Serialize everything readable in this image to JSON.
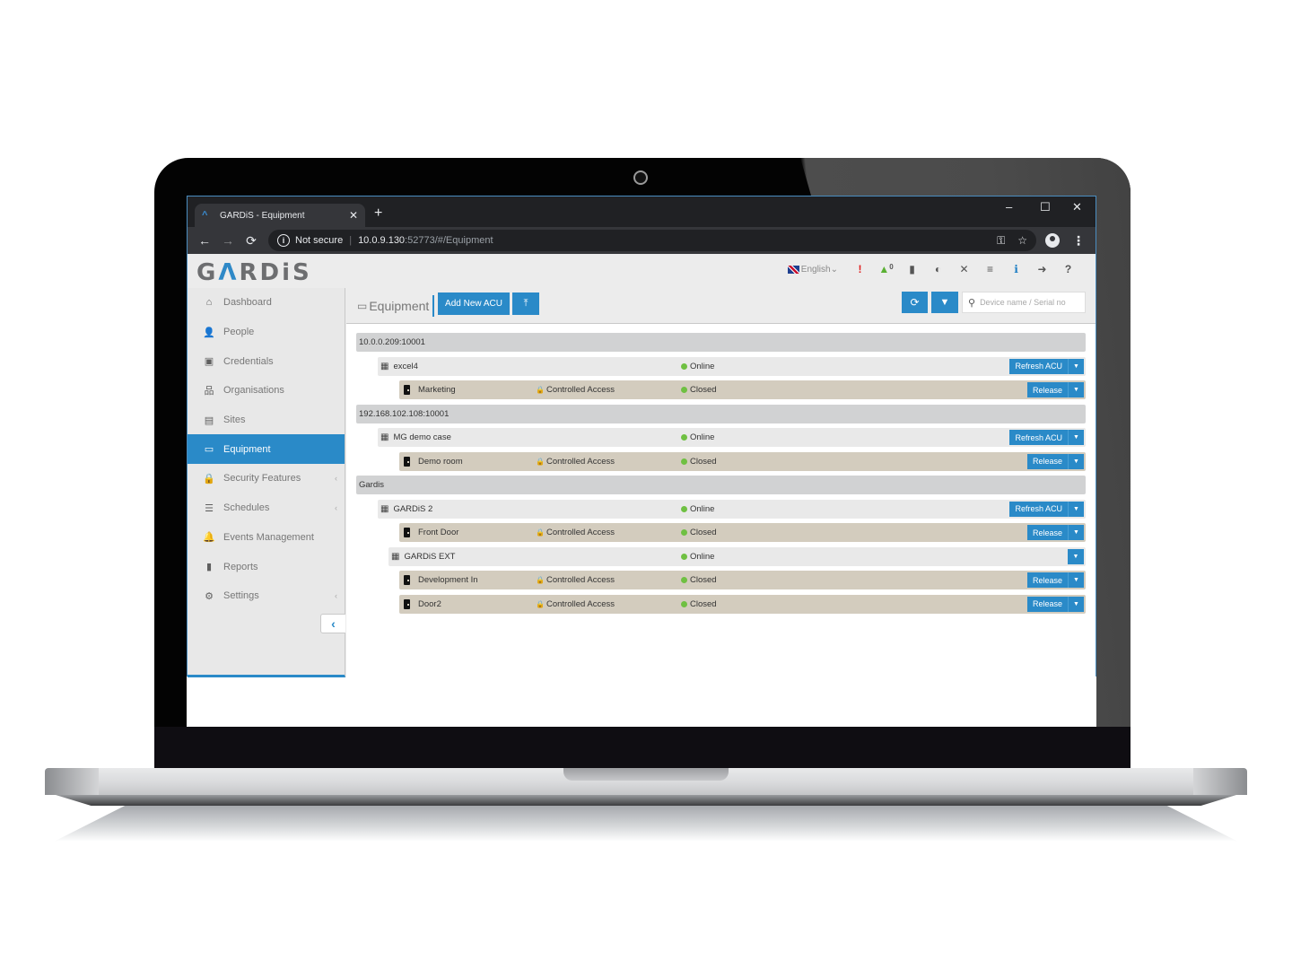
{
  "browser": {
    "tab_title": "GARDiS - Equipment",
    "tab_favicon": "gardis-chevron-icon",
    "new_tab": "+",
    "tab_close": "✕",
    "window_controls": {
      "minimize": "–",
      "maximize": "☐",
      "close": "✕"
    },
    "nav": {
      "back": "←",
      "forward": "→",
      "reload": "⟳"
    },
    "security_label": "Not secure",
    "url_host": "10.0.9.130",
    "url_rest": ":52773/#/Equipment",
    "omni_icons": {
      "key": "⚿",
      "star": "☆"
    },
    "menu": "⋮"
  },
  "app": {
    "logo": {
      "prefix": "G",
      "accent": "Λ",
      "suffix": "RDiS"
    },
    "header": {
      "language": "English",
      "language_caret": "⌄",
      "alert": "!",
      "bell": "🔔",
      "bell_count": "0",
      "reports": "▮",
      "contrast": "◐",
      "fullscreen": "✕",
      "menu": "≡",
      "info": "ℹ",
      "logout": "➜",
      "help": "?"
    },
    "colors": {
      "accent": "#2a8ac8",
      "online": "#6fc042",
      "alert": "#e02020",
      "door_row": "#d3ccbe",
      "group_row": "#d1d2d3"
    }
  },
  "sidebar": {
    "items": [
      {
        "label": "Dashboard",
        "icon": "⌂",
        "active": false,
        "has_submenu": false
      },
      {
        "label": "People",
        "icon": "👤",
        "active": false,
        "has_submenu": false
      },
      {
        "label": "Credentials",
        "icon": "▣",
        "active": false,
        "has_submenu": false
      },
      {
        "label": "Organisations",
        "icon": "品",
        "active": false,
        "has_submenu": false
      },
      {
        "label": "Sites",
        "icon": "▤",
        "active": false,
        "has_submenu": false
      },
      {
        "label": "Equipment",
        "icon": "▭",
        "active": true,
        "has_submenu": false
      },
      {
        "label": "Security Features",
        "icon": "🔒",
        "active": false,
        "has_submenu": true
      },
      {
        "label": "Schedules",
        "icon": "☰",
        "active": false,
        "has_submenu": true
      },
      {
        "label": "Events Management",
        "icon": "🔔",
        "active": false,
        "has_submenu": false
      },
      {
        "label": "Reports",
        "icon": "▮",
        "active": false,
        "has_submenu": false
      },
      {
        "label": "Settings",
        "icon": "⚙",
        "active": false,
        "has_submenu": true
      }
    ],
    "submenu_chevron": "‹",
    "collapse": "‹"
  },
  "main": {
    "title": "Equipment",
    "title_icon": "▭",
    "add_button": "Add New ACU",
    "upload_icon": "⤒",
    "refresh_icon": "⟳",
    "filter_icon": "▼",
    "search_icon": "⚲",
    "search_placeholder": "Device name / Serial no",
    "search_value": "",
    "tree": [
      {
        "type": "group",
        "name": "10.0.0.209:10001"
      },
      {
        "type": "acu",
        "name": "excel4",
        "status": "Online",
        "action": "Refresh ACU"
      },
      {
        "type": "door",
        "name": "Marketing",
        "access": "Controlled Access",
        "status": "Closed",
        "action": "Release"
      },
      {
        "type": "group",
        "name": "192.168.102.108:10001"
      },
      {
        "type": "acu",
        "name": "MG demo case",
        "status": "Online",
        "action": "Refresh ACU"
      },
      {
        "type": "door",
        "name": "Demo room",
        "access": "Controlled Access",
        "status": "Closed",
        "action": "Release"
      },
      {
        "type": "group",
        "name": "Gardis"
      },
      {
        "type": "acu",
        "name": "GARDiS 2",
        "status": "Online",
        "action": "Refresh ACU"
      },
      {
        "type": "door",
        "name": "Front Door",
        "access": "Controlled Access",
        "status": "Closed",
        "action": "Release"
      },
      {
        "type": "acu-sub",
        "name": "GARDiS EXT",
        "status": "Online",
        "action": ""
      },
      {
        "type": "door",
        "name": "Development In",
        "access": "Controlled Access",
        "status": "Closed",
        "action": "Release"
      },
      {
        "type": "door",
        "name": "Door2",
        "access": "Controlled Access",
        "status": "Closed",
        "action": "Release"
      }
    ],
    "lock_icon": "🔒",
    "caret_icon": "▼"
  }
}
